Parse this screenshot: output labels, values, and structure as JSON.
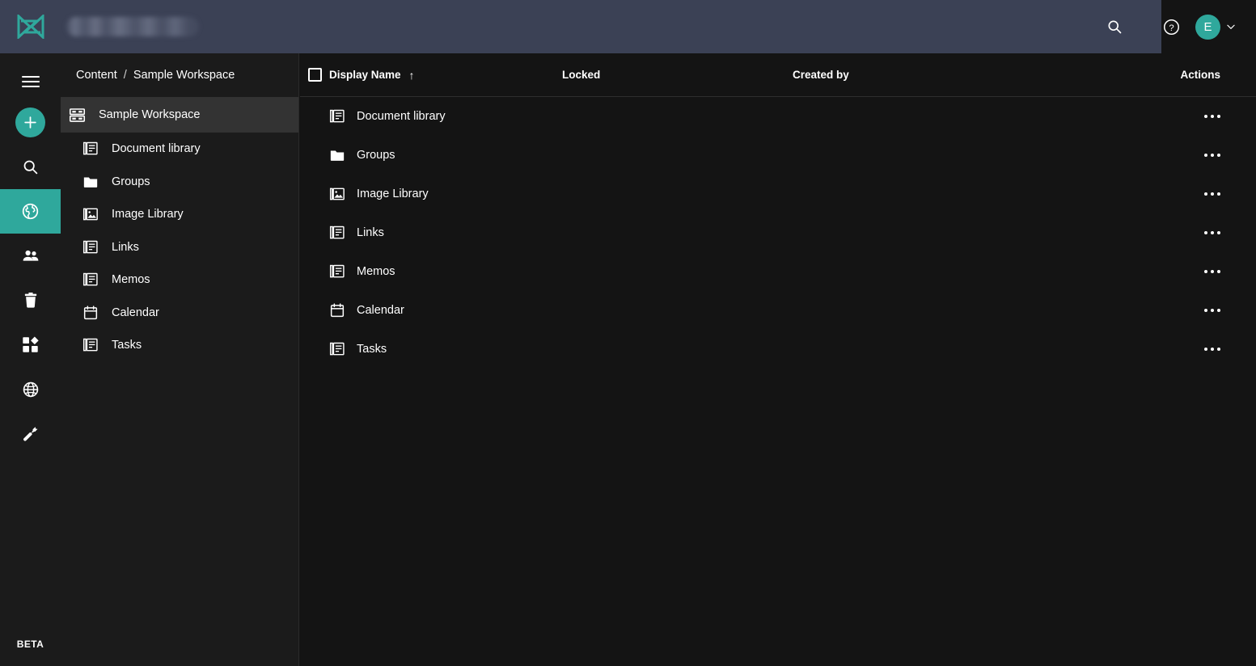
{
  "topbar": {
    "logo_name": "app-logo",
    "redacted_label": "",
    "search_icon": "search-icon",
    "help_icon": "help-circle-icon",
    "avatar_initial": "E",
    "chevron_icon": "chevron-down-icon",
    "accent_color": "#2fa89c",
    "bar_color": "#3b4155"
  },
  "rail": {
    "items": [
      {
        "name": "menu-toggle",
        "icon": "hamburger-icon",
        "selected": false
      },
      {
        "name": "create-new",
        "icon": "plus-icon",
        "selected": false
      },
      {
        "name": "search",
        "icon": "search-icon",
        "selected": false
      },
      {
        "name": "content",
        "icon": "globe-americas-icon",
        "selected": true
      },
      {
        "name": "users",
        "icon": "people-icon",
        "selected": false
      },
      {
        "name": "recycle-bin",
        "icon": "trash-icon",
        "selected": false
      },
      {
        "name": "dashboard",
        "icon": "dashboard-icon",
        "selected": false
      },
      {
        "name": "network",
        "icon": "globe-grid-icon",
        "selected": false
      },
      {
        "name": "settings",
        "icon": "wrench-icon",
        "selected": false
      }
    ],
    "beta_label": "BETA"
  },
  "breadcrumb": {
    "root": "Content",
    "separator": "/",
    "current": "Sample Workspace"
  },
  "sidebar": {
    "root": {
      "label": "Sample Workspace",
      "icon": "workspace-icon",
      "selected": true
    },
    "children": [
      {
        "label": "Document library",
        "icon": "document-library-icon"
      },
      {
        "label": "Groups",
        "icon": "folder-icon"
      },
      {
        "label": "Image Library",
        "icon": "image-library-icon"
      },
      {
        "label": "Links",
        "icon": "document-library-icon"
      },
      {
        "label": "Memos",
        "icon": "document-library-icon"
      },
      {
        "label": "Calendar",
        "icon": "calendar-icon"
      },
      {
        "label": "Tasks",
        "icon": "document-library-icon"
      }
    ]
  },
  "table": {
    "columns": {
      "display_name": "Display Name",
      "sort_indicator": "↑",
      "locked": "Locked",
      "created_by": "Created by",
      "actions": "Actions"
    },
    "rows": [
      {
        "display_name": "Document library",
        "icon": "document-library-icon",
        "locked": "",
        "created_by": ""
      },
      {
        "display_name": "Groups",
        "icon": "folder-icon",
        "locked": "",
        "created_by": ""
      },
      {
        "display_name": "Image Library",
        "icon": "image-library-icon",
        "locked": "",
        "created_by": ""
      },
      {
        "display_name": "Links",
        "icon": "document-library-icon",
        "locked": "",
        "created_by": ""
      },
      {
        "display_name": "Memos",
        "icon": "document-library-icon",
        "locked": "",
        "created_by": ""
      },
      {
        "display_name": "Calendar",
        "icon": "calendar-icon",
        "locked": "",
        "created_by": ""
      },
      {
        "display_name": "Tasks",
        "icon": "document-library-icon",
        "locked": "",
        "created_by": ""
      }
    ]
  }
}
